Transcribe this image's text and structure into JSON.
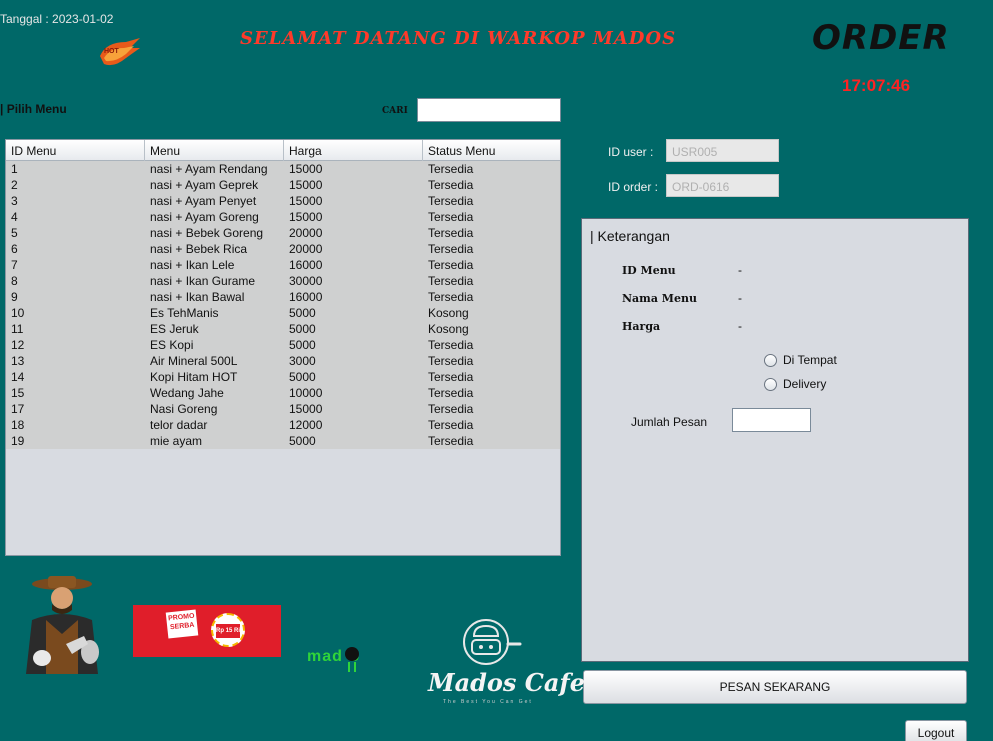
{
  "header": {
    "date_label": "Tanggal  : 2023-01-02",
    "welcome": "SELAMAT DATANG DI WARKOP MADOS",
    "title": "ORDER",
    "clock": "17:07:46"
  },
  "menu_section": {
    "title": "| Pilih Menu",
    "search_label": "CARI",
    "search_value": ""
  },
  "table": {
    "columns": [
      "ID Menu",
      "Menu",
      "Harga",
      "Status Menu"
    ],
    "rows": [
      [
        "1",
        "nasi + Ayam Rendang",
        "15000",
        "Tersedia"
      ],
      [
        "2",
        "nasi + Ayam Geprek",
        "15000",
        "Tersedia"
      ],
      [
        "3",
        "nasi + Ayam Penyet",
        "15000",
        "Tersedia"
      ],
      [
        "4",
        "nasi + Ayam Goreng",
        "15000",
        "Tersedia"
      ],
      [
        "5",
        "nasi + Bebek Goreng",
        "20000",
        "Tersedia"
      ],
      [
        "6",
        "nasi + Bebek Rica",
        "20000",
        "Tersedia"
      ],
      [
        "7",
        "nasi + Ikan Lele",
        "16000",
        "Tersedia"
      ],
      [
        "8",
        "nasi + Ikan Gurame",
        "30000",
        "Tersedia"
      ],
      [
        "9",
        "nasi + Ikan Bawal",
        "16000",
        "Tersedia"
      ],
      [
        "10",
        "Es TehManis",
        "5000",
        "Kosong"
      ],
      [
        "11",
        "ES Jeruk",
        "5000",
        "Kosong"
      ],
      [
        "12",
        "ES Kopi",
        "5000",
        "Tersedia"
      ],
      [
        "13",
        "Air Mineral 500L",
        "3000",
        "Tersedia"
      ],
      [
        "14",
        "Kopi Hitam HOT",
        "5000",
        "Tersedia"
      ],
      [
        "15",
        "Wedang Jahe",
        "10000",
        "Tersedia"
      ],
      [
        "17",
        "Nasi Goreng",
        "15000",
        "Tersedia"
      ],
      [
        "18",
        "telor dadar",
        "12000",
        "Tersedia"
      ],
      [
        "19",
        "mie ayam",
        "5000",
        "Tersedia"
      ]
    ]
  },
  "user": {
    "id_user_label": "ID user :",
    "id_user_value": "USR005",
    "id_order_label": "ID order :",
    "id_order_value": "ORD-0616"
  },
  "keterangan": {
    "title": "| Keterangan",
    "id_menu_label": "ID Menu",
    "id_menu_value": "-",
    "nama_menu_label": "Nama Menu",
    "nama_menu_value": "-",
    "harga_label": "Harga",
    "harga_value": "-",
    "option_1": "Di Tempat",
    "option_2": "Delivery",
    "jumlah_label": "Jumlah Pesan",
    "jumlah_value": ""
  },
  "buttons": {
    "pesan": "PESAN SEKARANG",
    "logout": "Logout"
  },
  "branding": {
    "promo_line1": "PROMO",
    "promo_line2": "SERBA",
    "promo_price": "Rp 15 Ribu",
    "mados_logo": "mad S",
    "cafe_name": "Mados Cafe",
    "cafe_tagline": "The Best You Can Get",
    "hot_badge": "HOT"
  },
  "colors": {
    "background": "#006868",
    "accent_red": "#ff2222",
    "logo_green": "#2fd43a"
  }
}
